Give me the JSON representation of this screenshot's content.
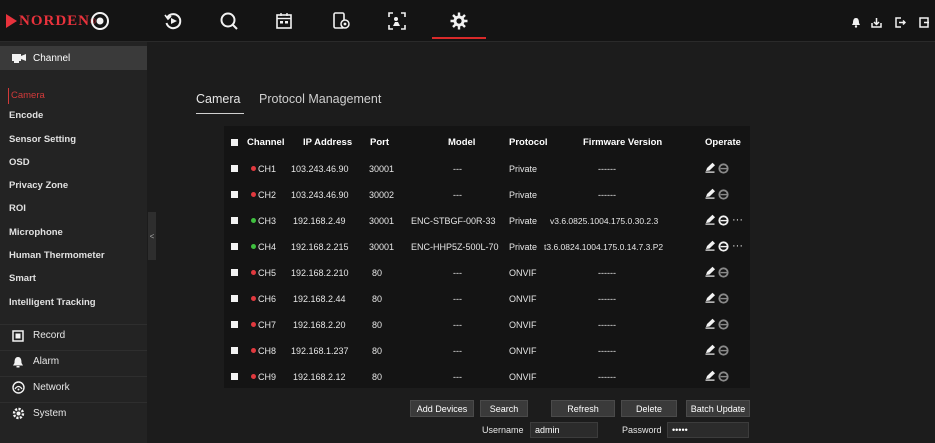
{
  "brand": {
    "name": "NORDEN",
    "reg": "®"
  },
  "sidebar": {
    "header": "Channel",
    "sub_items": [
      {
        "label": "Camera",
        "active": true
      },
      {
        "label": "Encode"
      },
      {
        "label": "Sensor Setting"
      },
      {
        "label": "OSD"
      },
      {
        "label": "Privacy Zone"
      },
      {
        "label": "ROI"
      },
      {
        "label": "Microphone"
      },
      {
        "label": "Human Thermometer"
      },
      {
        "label": "Smart"
      },
      {
        "label": "Intelligent Tracking"
      }
    ],
    "main_items": [
      {
        "label": "Record",
        "icon": "record-icon"
      },
      {
        "label": "Alarm",
        "icon": "alarm-icon"
      },
      {
        "label": "Network",
        "icon": "network-icon"
      },
      {
        "label": "System",
        "icon": "system-icon"
      }
    ],
    "collapse_glyph": "<"
  },
  "tabs": [
    {
      "label": "Camera",
      "active": true
    },
    {
      "label": "Protocol Management"
    }
  ],
  "table": {
    "headers": {
      "channel": "Channel",
      "ip": "IP Address",
      "port": "Port",
      "model": "Model",
      "protocol": "Protocol",
      "firmware": "Firmware Version",
      "operate": "Operate"
    },
    "rows": [
      {
        "channel": "CH1",
        "ip": "103.243.46.90",
        "port": "30001",
        "model": "---",
        "protocol": "Private",
        "firmware": "------",
        "online": false
      },
      {
        "channel": "CH2",
        "ip": "103.243.46.90",
        "port": "30002",
        "model": "---",
        "protocol": "Private",
        "firmware": "------",
        "online": false
      },
      {
        "channel": "CH3",
        "ip": "192.168.2.49",
        "port": "30001",
        "model": "ENC-STBGF-00R-33",
        "protocol": "Private",
        "firmware": "v3.6.0825.1004.175.0.30.2.3",
        "online": true
      },
      {
        "channel": "CH4",
        "ip": "192.168.2.215",
        "port": "30001",
        "model": "ENC-HHP5Z-500L-70",
        "protocol": "Private",
        "firmware": "t3.6.0824.1004.175.0.14.7.3.P2",
        "online": true
      },
      {
        "channel": "CH5",
        "ip": "192.168.2.210",
        "port": "80",
        "model": "---",
        "protocol": "ONVIF",
        "firmware": "------",
        "online": false
      },
      {
        "channel": "CH6",
        "ip": "192.168.2.44",
        "port": "80",
        "model": "---",
        "protocol": "ONVIF",
        "firmware": "------",
        "online": false
      },
      {
        "channel": "CH7",
        "ip": "192.168.2.20",
        "port": "80",
        "model": "---",
        "protocol": "ONVIF",
        "firmware": "------",
        "online": false
      },
      {
        "channel": "CH8",
        "ip": "192.168.1.237",
        "port": "80",
        "model": "---",
        "protocol": "ONVIF",
        "firmware": "------",
        "online": false
      },
      {
        "channel": "CH9",
        "ip": "192.168.2.12",
        "port": "80",
        "model": "---",
        "protocol": "ONVIF",
        "firmware": "------",
        "online": false
      }
    ],
    "more_glyph": "···"
  },
  "buttons": {
    "add_devices": "Add Devices",
    "search": "Search",
    "refresh": "Refresh",
    "delete": "Delete",
    "batch_update": "Batch Update"
  },
  "login": {
    "username_label": "Username",
    "username_value": "admin",
    "password_label": "Password",
    "password_value": "•••••"
  },
  "colors": {
    "offline_dot": "#e0393e",
    "online_dot": "#3fbf3f",
    "accent": "#d23a3a",
    "brand": "#e8323c"
  }
}
